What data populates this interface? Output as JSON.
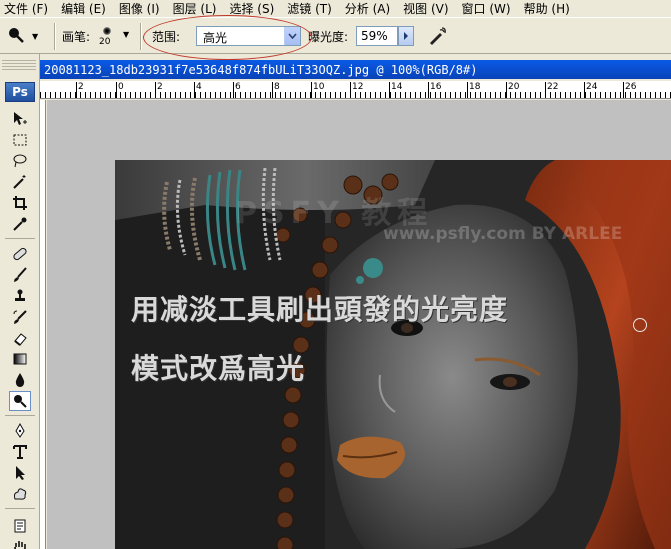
{
  "menubar": {
    "items": [
      "文件 (F)",
      "编辑 (E)",
      "图像 (I)",
      "图层 (L)",
      "选择 (S)",
      "滤镜 (T)",
      "分析 (A)",
      "视图 (V)",
      "窗口 (W)",
      "帮助 (H)"
    ]
  },
  "options": {
    "brush_label": "画笔:",
    "brush_size": "20",
    "range_label": "范围:",
    "range_value": "高光",
    "exposure_label": "曝光度:",
    "exposure_value": "59%"
  },
  "toolbox": {
    "logo": "Ps"
  },
  "document": {
    "title": "20081123_18db23931f7e53648f874fbULiT33OQZ.jpg @ 100%(RGB/8#)"
  },
  "ruler": {
    "labels": [
      "2",
      "0",
      "2",
      "4",
      "6",
      "8",
      "10",
      "12",
      "14",
      "16",
      "18",
      "20",
      "22",
      "24",
      "26"
    ]
  },
  "canvas": {
    "watermark": "PSFY 教程",
    "watermark_sub": "www.psfly.com BY ARLEE",
    "overlay_line1": "用减淡工具刷出頭發的光亮度",
    "overlay_line2": "模式改爲高光"
  },
  "colors": {
    "title_bar": "#0a5ae6",
    "annotation_oval": "#c0392b",
    "chrome": "#ece9d8"
  }
}
